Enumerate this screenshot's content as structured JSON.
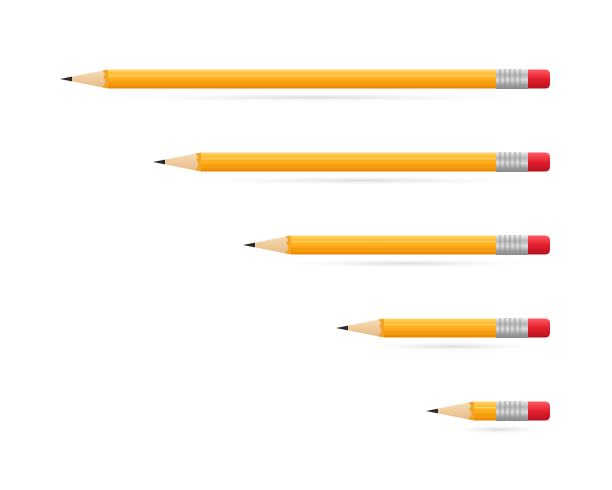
{
  "scene": {
    "background": "#ffffff",
    "subject": "pencil",
    "pencil_count": 5,
    "colors": {
      "body_top": "#ffcf5c",
      "body_mid": "#ffb51c",
      "body_bottom": "#f08a00",
      "wood": "#f6d3a6",
      "lead": "#2a2a2a",
      "ferrule": "#b8b8b8",
      "eraser": "#e0202f",
      "shadow": "#d9d9d9"
    }
  }
}
